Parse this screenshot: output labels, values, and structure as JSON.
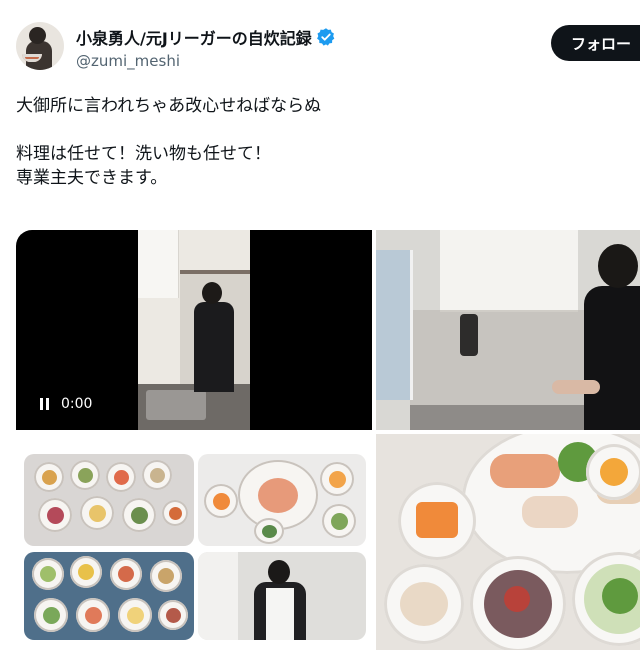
{
  "user": {
    "display_name": "小泉勇人/元Jリーガーの自炊記録",
    "handle": "@zumi_meshi",
    "verified": true,
    "verified_icon": "verified-badge-icon",
    "verified_color": "#1d9bf0"
  },
  "actions": {
    "follow_label": "フォロー"
  },
  "tweet": {
    "lines": [
      "大御所に言われちゃあ改心せねばならぬ",
      "料理は任せて！洗い物も任せて！",
      "専業主夫できます。"
    ]
  },
  "media": {
    "video": {
      "time": "0:00",
      "control_icon": "pause-icon"
    }
  },
  "colors": {
    "text": "#0f1419",
    "secondary_text": "#536471",
    "button_bg": "#0f1419",
    "button_text": "#ffffff"
  }
}
